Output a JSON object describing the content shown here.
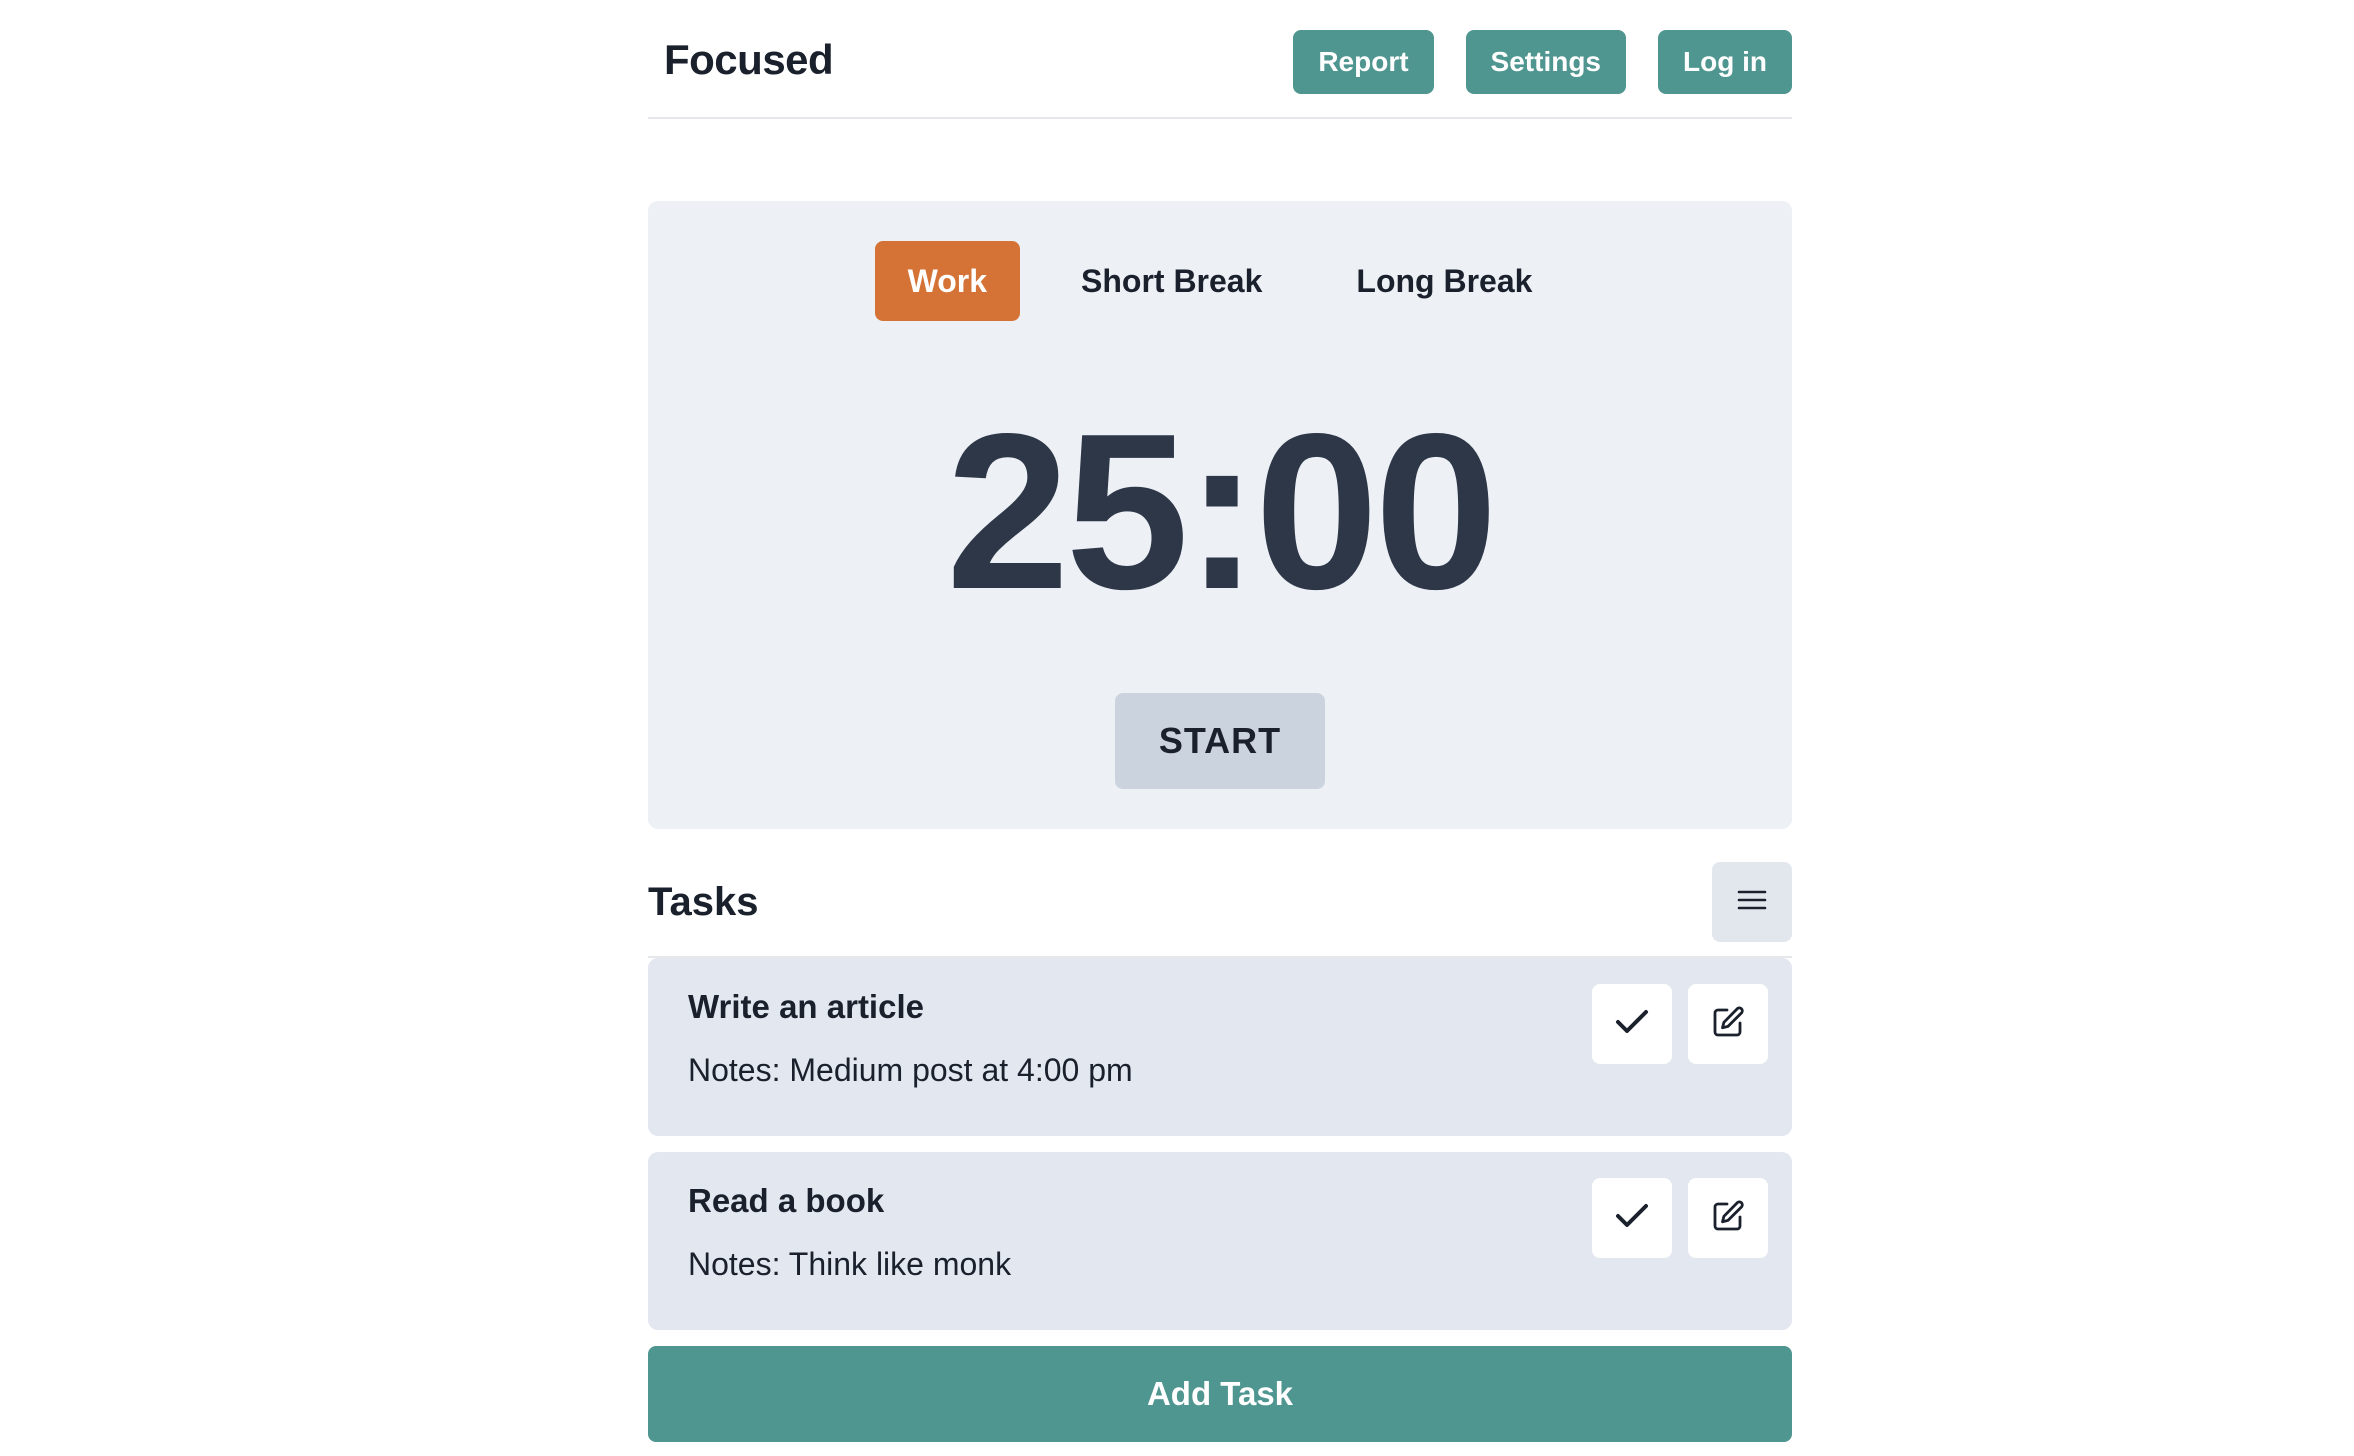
{
  "app": {
    "brand": "Focused"
  },
  "nav": {
    "report_label": "Report",
    "settings_label": "Settings",
    "login_label": "Log in"
  },
  "timer": {
    "modes": [
      {
        "label": "Work",
        "active": true
      },
      {
        "label": "Short Break",
        "active": false
      },
      {
        "label": "Long Break",
        "active": false
      }
    ],
    "time": "25:00",
    "start_label": "START"
  },
  "tasks": {
    "title": "Tasks",
    "items": [
      {
        "title": "Write an article",
        "notes": "Notes: Medium post at 4:00 pm"
      },
      {
        "title": "Read a book",
        "notes": "Notes: Think like monk"
      }
    ],
    "add_label": "Add Task"
  },
  "icons": {
    "menu": "menu-icon",
    "check": "check-icon",
    "edit": "edit-icon"
  },
  "colors": {
    "accent": "#4f9590",
    "work_active": "#d47335",
    "card_bg": "#edf0f5",
    "task_bg": "#e2e7f0",
    "timer_text": "#2d3748"
  }
}
